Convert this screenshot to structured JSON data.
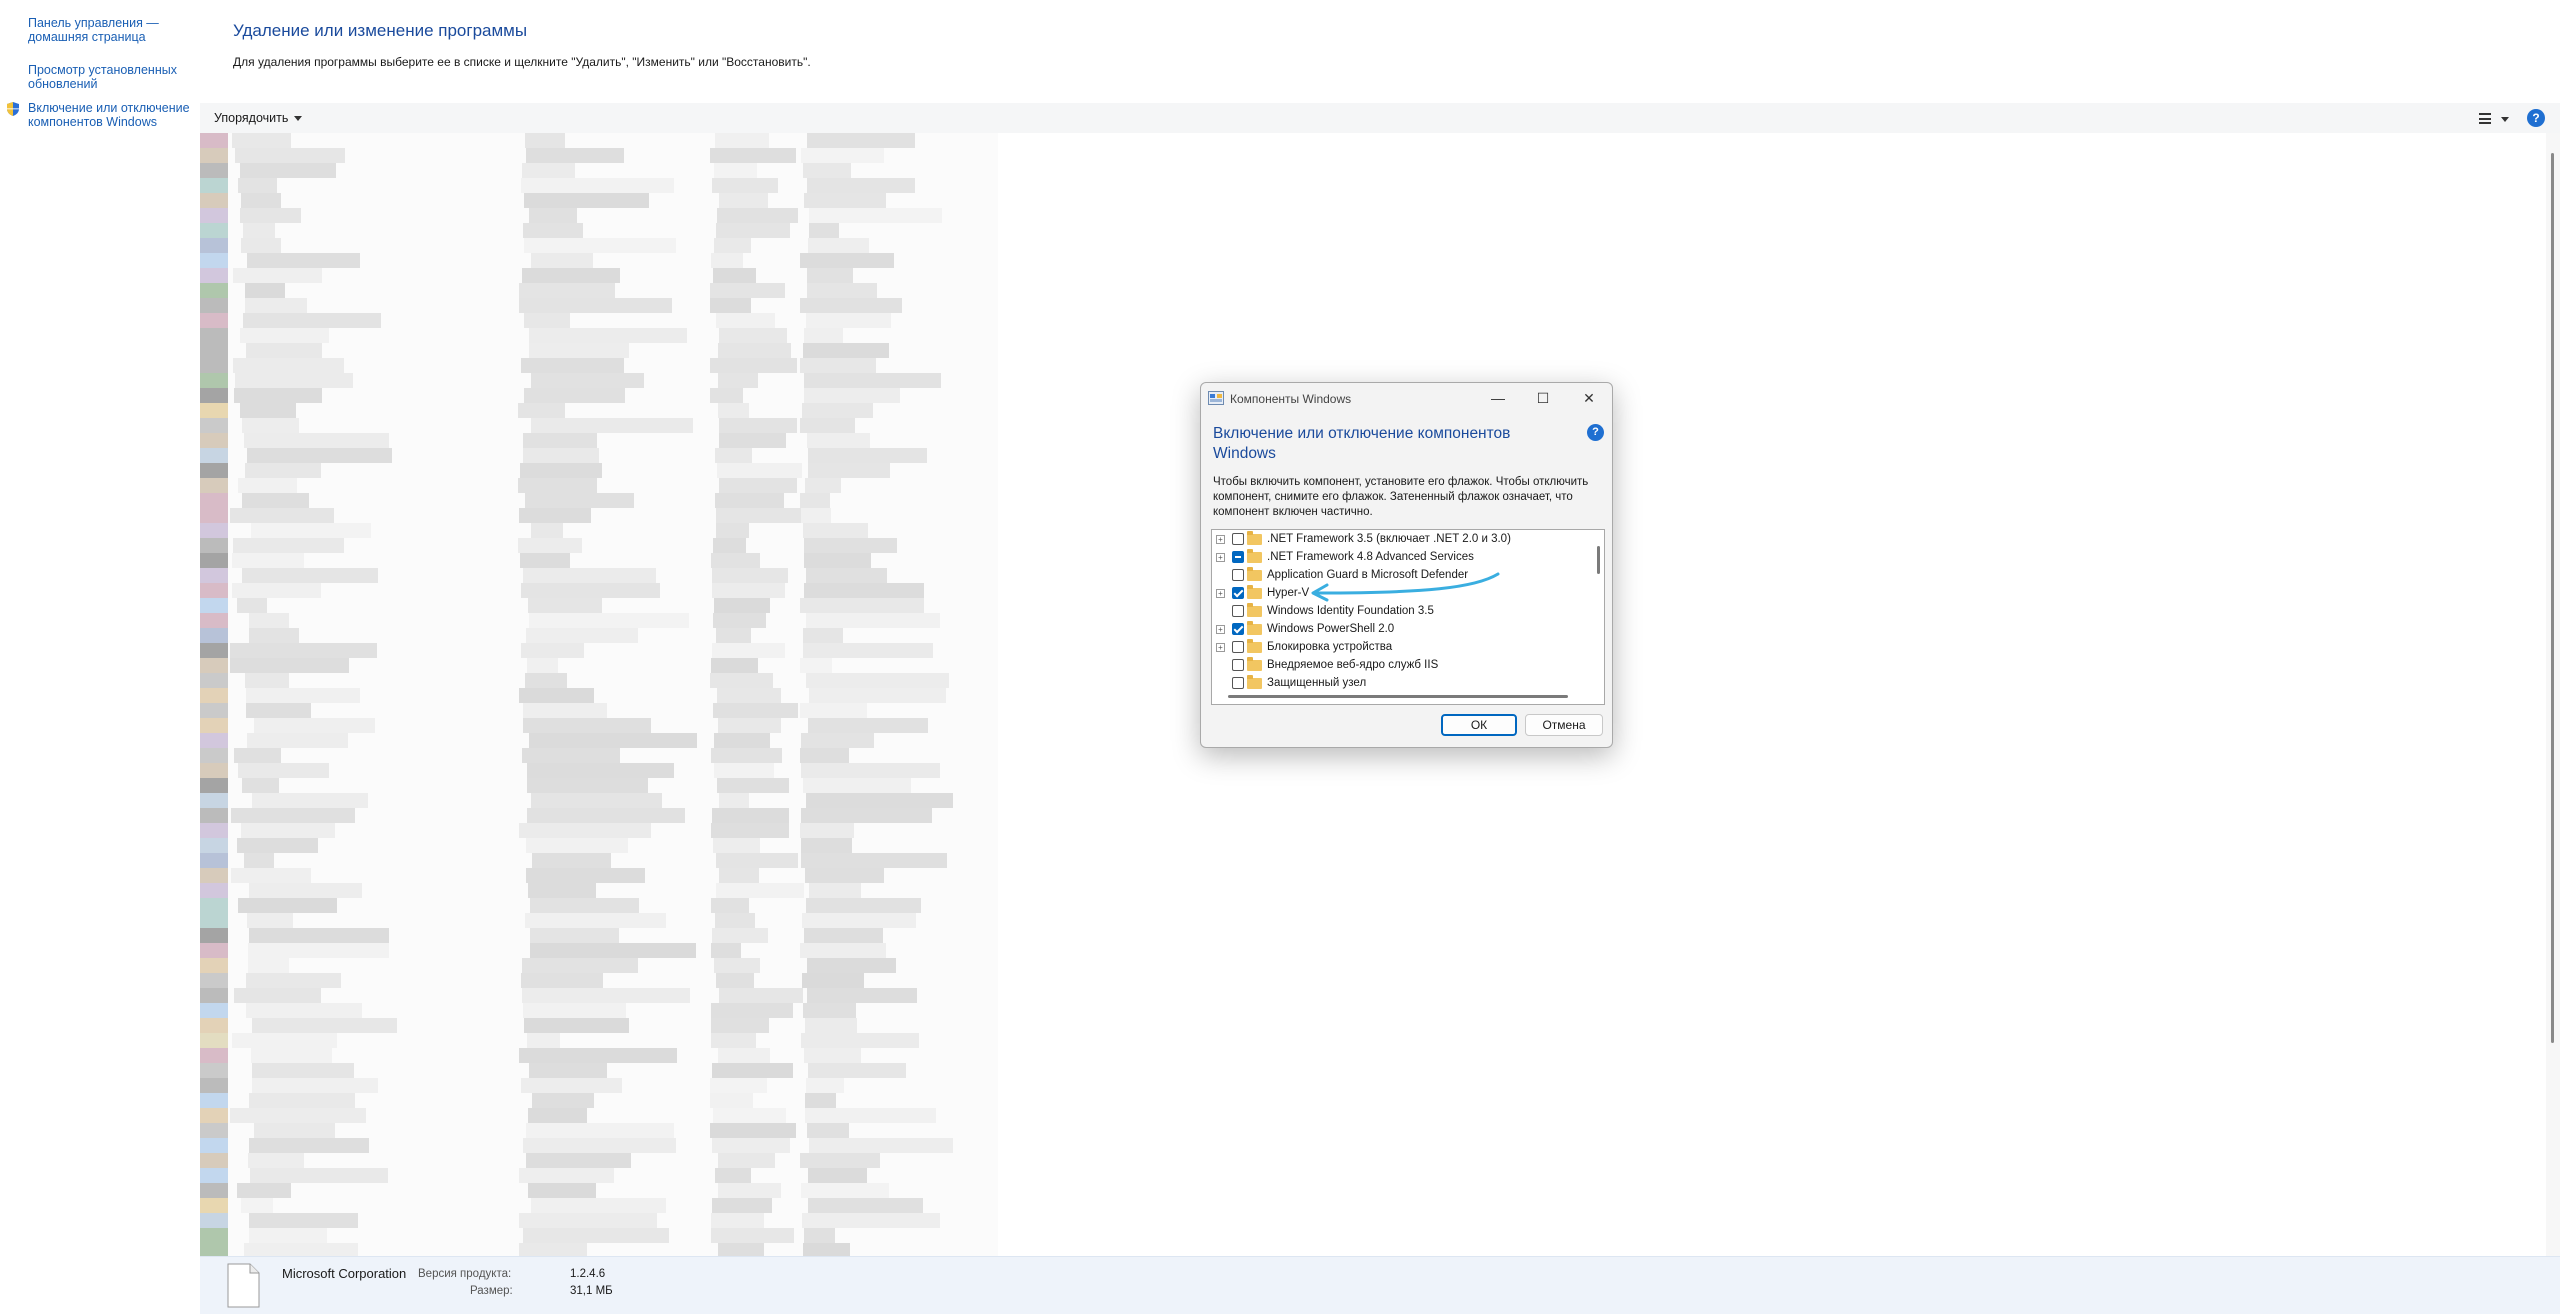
{
  "left_tasks": {
    "home": "Панель управления — домашняя страница",
    "updates": "Просмотр установленных обновлений",
    "features": "Включение или отключение компонентов Windows"
  },
  "header": {
    "title": "Удаление или изменение программы",
    "description": "Для удаления программы выберите ее в списке и щелкните \"Удалить\", \"Изменить\" или \"Восстановить\"."
  },
  "toolbar": {
    "organize_label": "Упорядочить",
    "help_label": "?"
  },
  "details": {
    "publisher": "Microsoft Corporation",
    "version_label": "Версия продукта:",
    "version_value": "1.2.4.6",
    "size_label": "Размер:",
    "size_value": "31,1 МБ"
  },
  "dialog": {
    "window_title": "Компоненты Windows",
    "heading": "Включение или отключение компонентов Windows",
    "description": "Чтобы включить компонент, установите его флажок. Чтобы отключить компонент, снимите его флажок. Затененный флажок означает, что компонент включен частично.",
    "help_label": "?",
    "ok_label": "ОК",
    "cancel_label": "Отмена",
    "minimize_glyph": "—",
    "maximize_glyph": "☐",
    "close_glyph": "✕",
    "features": [
      {
        "label": ".NET Framework 3.5 (включает .NET 2.0 и 3.0)",
        "expandable": true,
        "state": "unchecked"
      },
      {
        "label": ".NET Framework 4.8 Advanced Services",
        "expandable": true,
        "state": "partial"
      },
      {
        "label": "Application Guard в Microsoft Defender",
        "expandable": false,
        "state": "unchecked"
      },
      {
        "label": "Hyper-V",
        "expandable": true,
        "state": "checked"
      },
      {
        "label": "Windows Identity Foundation 3.5",
        "expandable": false,
        "state": "unchecked"
      },
      {
        "label": "Windows PowerShell 2.0",
        "expandable": true,
        "state": "checked"
      },
      {
        "label": "Блокировка устройства",
        "expandable": true,
        "state": "unchecked"
      },
      {
        "label": "Внедряемое веб-ядро служб IIS",
        "expandable": false,
        "state": "unchecked"
      },
      {
        "label": "Защищенный узел",
        "expandable": false,
        "state": "unchecked"
      }
    ]
  },
  "colors": {
    "link": "#1a5fb4",
    "title_blue": "#1a4a9c",
    "accent": "#0067c0",
    "annotation_arrow": "#3aaee0"
  },
  "icons": {
    "shield": "uac-shield-icon",
    "file": "file-icon",
    "dialog": "windows-features-icon"
  }
}
